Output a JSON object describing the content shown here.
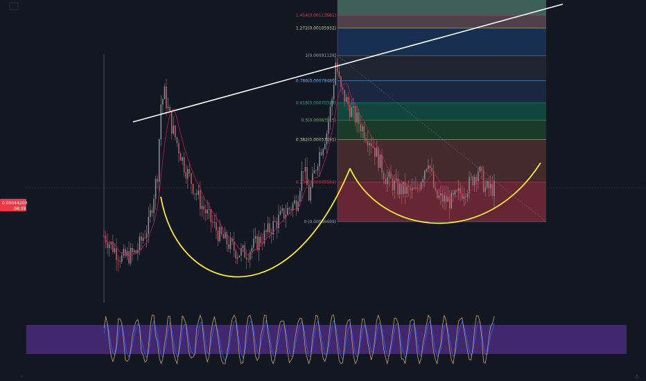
{
  "colors": {
    "background": "#131722",
    "candle_up": "#8a8f98",
    "candle_down": "#c06060",
    "moving_average": "#c2185b",
    "trendline": "#ffffff",
    "cup_curve": "#ffeb3b",
    "price_tag_bg": "#f23645",
    "oscillator_band": "#4a2a7a",
    "oscillator_k": "#c9a27a",
    "oscillator_d": "#2962ff"
  },
  "price_tag": {
    "price": "0.00044200",
    "countdown": "08:39"
  },
  "icons": [
    "chart-logo-icon",
    "expand-corner-icon"
  ],
  "chart_data": {
    "type": "candlestick",
    "title": "",
    "price_scale": "log",
    "ylim": [
      0.00024,
      0.00122
    ],
    "current_price": 0.000442,
    "fib_retracement": {
      "levels": [
        {
          "ratio": 0,
          "price": 0.00036699,
          "label": "0 (0.00036699)",
          "zone_color": "#8b2e3c"
        },
        {
          "ratio": 0.236,
          "price": 0.00045564,
          "label": "0.236(0.00045564)",
          "zone_color": "#5a3232"
        },
        {
          "ratio": 0.382,
          "price": 0.00057491,
          "label": "0.382(0.00057491)",
          "zone_color": "#1f4a2a"
        },
        {
          "ratio": 0.5,
          "price": 0.00063915,
          "label": "0.5(0.00063915)",
          "zone_color": "#135a4a"
        },
        {
          "ratio": 0.618,
          "price": 0.00070336,
          "label": "0.618(0.00070336)",
          "zone_color": "#1e2f4a"
        },
        {
          "ratio": 0.786,
          "price": 0.0007948,
          "label": "0.786(0.00079480)",
          "zone_color": "#262b36"
        },
        {
          "ratio": 1,
          "price": 0.00091128,
          "label": "1(0.00091128)",
          "zone_color": "#1b3a66"
        },
        {
          "ratio": 1.272,
          "price": 0.00105932,
          "label": "1.272(0.00105932)",
          "zone_color": "#6b5358"
        },
        {
          "ratio": 1.414,
          "price": 0.00113661,
          "label": "1.414(0.00113661)",
          "zone_color": "#4e7f6d"
        }
      ],
      "label_colors": {
        "0": "#9aa0a6",
        "0.236": "#f23645",
        "0.382": "#c7d0a0",
        "0.5": "#66bb6a",
        "0.618": "#26a69a",
        "0.786": "#64b5f6",
        "1": "#9aa0a6",
        "1.272": "#c7d0a0",
        "1.414": "#f23645"
      }
    },
    "price_series": {
      "bars": 220,
      "anchors": [
        [
          0,
          0.00034
        ],
        [
          10,
          0.0003
        ],
        [
          18,
          0.00031
        ],
        [
          25,
          0.00036
        ],
        [
          30,
          0.00048
        ],
        [
          32,
          0.0007
        ],
        [
          34,
          0.00074
        ],
        [
          38,
          0.00062
        ],
        [
          45,
          0.0005
        ],
        [
          55,
          0.0004
        ],
        [
          65,
          0.00034
        ],
        [
          75,
          0.00031
        ],
        [
          80,
          0.00031
        ],
        [
          90,
          0.00034
        ],
        [
          100,
          0.00038
        ],
        [
          108,
          0.00041
        ],
        [
          112,
          0.0005
        ],
        [
          115,
          0.00042
        ],
        [
          120,
          0.00052
        ],
        [
          125,
          0.0006
        ],
        [
          128,
          0.00072
        ],
        [
          130,
          0.00088
        ],
        [
          133,
          0.00075
        ],
        [
          140,
          0.00066
        ],
        [
          150,
          0.00057
        ],
        [
          158,
          0.00047
        ],
        [
          165,
          0.00044
        ],
        [
          175,
          0.00043
        ],
        [
          182,
          0.00052
        ],
        [
          186,
          0.00042
        ],
        [
          195,
          0.00041
        ],
        [
          205,
          0.00045
        ],
        [
          210,
          0.00049
        ],
        [
          214,
          0.00044
        ],
        [
          219,
          0.00044
        ]
      ]
    },
    "oscillator": {
      "type": "stochastic_rsi",
      "ylim": [
        0,
        100
      ],
      "band": [
        20,
        80
      ]
    }
  }
}
